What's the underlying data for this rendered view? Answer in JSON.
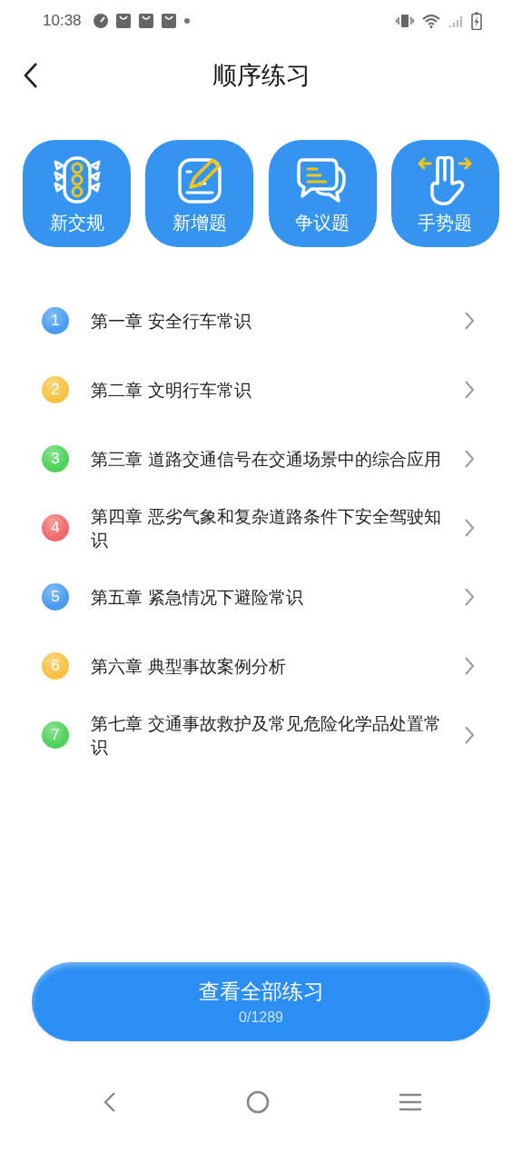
{
  "status_bar": {
    "time": "10:38"
  },
  "header": {
    "title": "顺序练习"
  },
  "categories": [
    {
      "kind": "traffic-light",
      "label": "新交规"
    },
    {
      "kind": "pencil",
      "label": "新增题"
    },
    {
      "kind": "chat",
      "label": "争议题"
    },
    {
      "kind": "gesture",
      "label": "手势题"
    }
  ],
  "chapters": [
    {
      "number": "1",
      "color": "#4a9cf0",
      "title": "第一章  安全行车常识"
    },
    {
      "number": "2",
      "color": "#f7c242",
      "title": "第二章  文明行车常识"
    },
    {
      "number": "3",
      "color": "#4fd35a",
      "title": "第三章  道路交通信号在交通场景中的综合应用"
    },
    {
      "number": "4",
      "color": "#f06a6a",
      "title": "第四章  恶劣气象和复杂道路条件下安全驾驶知识"
    },
    {
      "number": "5",
      "color": "#4a9cf0",
      "title": "第五章  紧急情况下避险常识"
    },
    {
      "number": "6",
      "color": "#f7c242",
      "title": "第六章  典型事故案例分析"
    },
    {
      "number": "7",
      "color": "#4fd35a",
      "title": "第七章  交通事故救护及常见危险化学品处置常识"
    }
  ],
  "action": {
    "label": "查看全部练习",
    "progress": "0/1289"
  }
}
